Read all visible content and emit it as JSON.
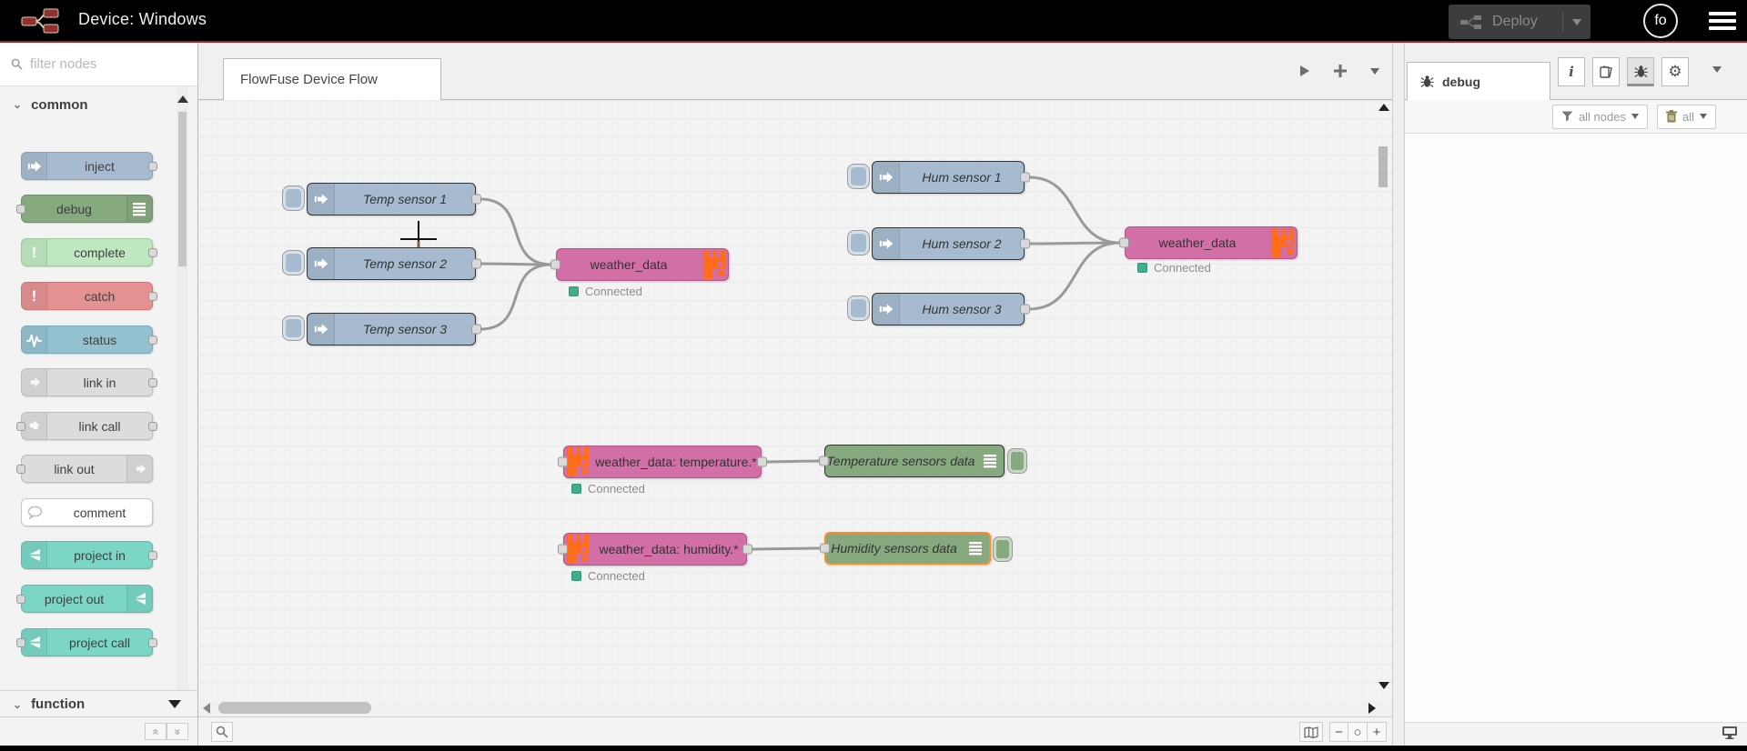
{
  "header": {
    "title": "Device: Windows",
    "deploy_label": "Deploy",
    "avatar_text": "fo"
  },
  "palette": {
    "search_placeholder": "filter nodes",
    "category_common": "common",
    "category_function": "function",
    "nodes": [
      {
        "label": "inject"
      },
      {
        "label": "debug"
      },
      {
        "label": "complete"
      },
      {
        "label": "catch"
      },
      {
        "label": "status"
      },
      {
        "label": "link in"
      },
      {
        "label": "link call"
      },
      {
        "label": "link out"
      },
      {
        "label": "comment"
      },
      {
        "label": "project in"
      },
      {
        "label": "project out"
      },
      {
        "label": "project call"
      }
    ]
  },
  "workspace": {
    "tab_label": "FlowFuse Device Flow"
  },
  "canvas": {
    "temp1": "Temp sensor 1",
    "temp2": "Temp sensor 2",
    "temp3": "Temp sensor 3",
    "hum1": "Hum sensor 1",
    "hum2": "Hum sensor 2",
    "hum3": "Hum sensor 3",
    "weather_left": {
      "label": "weather_data",
      "status": "Connected"
    },
    "weather_right": {
      "label": "weather_data",
      "status": "Connected"
    },
    "wd_temperature": {
      "label": "weather_data: temperature.*",
      "status": "Connected"
    },
    "wd_humidity": {
      "label": "weather_data: humidity.*",
      "status": "Connected"
    },
    "debug_temperature": {
      "label": "Temperature sensors data"
    },
    "debug_humidity": {
      "label": "Humidity sensors data"
    }
  },
  "sidebar": {
    "active_tab": "debug",
    "filter_label": "all nodes",
    "clear_label": "all"
  },
  "colors": {
    "header_accent_line": "#9c2a2a",
    "node_inject": "#a6bbcf",
    "node_debug": "#87a980",
    "node_complete": "#c0e8c0",
    "node_catch": "#e49191",
    "node_status": "#94c1d0",
    "node_link": "#dcdcdc",
    "node_project": "#7bd6c6",
    "node_weather_pink": "#d16fa6",
    "flowfuse_orange": "#ff6c1a",
    "status_connected_green": "#3fae8a",
    "selection_orange": "#ff8b25"
  }
}
